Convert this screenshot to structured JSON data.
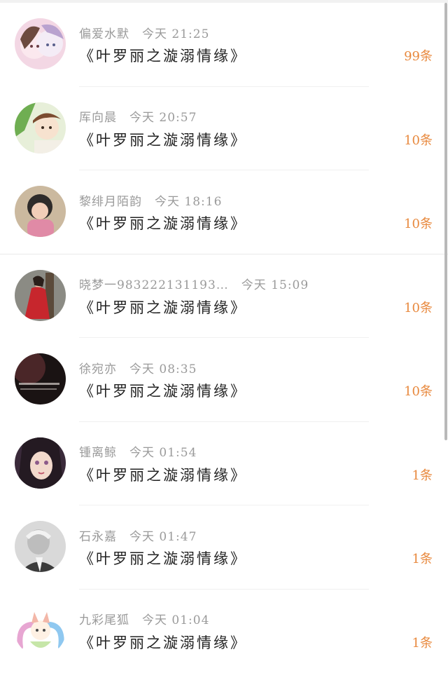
{
  "comments": [
    {
      "name": "偏爱水默",
      "time": "今天 21:25",
      "title": "《叶罗丽之漩溺情缘》",
      "count": "99条",
      "avatar": "anime-girls-avatar",
      "avatar_colors": [
        "#f3d7e4",
        "#b9a2cf",
        "#6d4a3f"
      ]
    },
    {
      "name": "厍向晨",
      "time": "今天 20:57",
      "title": "《叶罗丽之漩溺情缘》",
      "count": "10条",
      "avatar": "anime-boy-avatar",
      "avatar_colors": [
        "#e7efd9",
        "#6fae52",
        "#7b4b2f"
      ]
    },
    {
      "name": "黎绯月陌韵",
      "time": "今天 18:16",
      "title": "《叶罗丽之漩溺情缘》",
      "count": "10条",
      "avatar": "child-photo-avatar",
      "avatar_colors": [
        "#cbb99f",
        "#e08aa6",
        "#2e2b2a"
      ]
    },
    {
      "name": "晓梦一983222131193…",
      "time": "今天 15:09",
      "title": "《叶罗丽之漩溺情缘》",
      "count": "10条",
      "avatar": "woman-red-dress-avatar",
      "avatar_colors": [
        "#8b8b84",
        "#c7262d",
        "#2a1f1a"
      ]
    },
    {
      "name": "徐宛亦",
      "time": "今天 08:35",
      "title": "《叶罗丽之漩溺情缘》",
      "count": "10条",
      "avatar": "dark-text-avatar",
      "avatar_colors": [
        "#4a2628",
        "#1a1313",
        "#d7cfca"
      ]
    },
    {
      "name": "锺离鲸",
      "time": "今天 01:54",
      "title": "《叶罗丽之漩溺情缘》",
      "count": "1条",
      "avatar": "anime-dark-hair-avatar",
      "avatar_colors": [
        "#3a2a3a",
        "#f2d9cc",
        "#8c5a8a"
      ]
    },
    {
      "name": "石永嘉",
      "time": "今天 01:47",
      "title": "《叶罗丽之漩溺情缘》",
      "count": "1条",
      "avatar": "man-portrait-avatar",
      "avatar_colors": [
        "#d9d9d9",
        "#3b3b3b",
        "#9a9a9a"
      ]
    },
    {
      "name": "九彩尾狐",
      "time": "今天 01:04",
      "title": "《叶罗丽之漩溺情缘》",
      "count": "1条",
      "avatar": "rainbow-fox-avatar",
      "avatar_colors": [
        "#ffffff",
        "#e7a6d2",
        "#8fc8f0"
      ]
    }
  ]
}
